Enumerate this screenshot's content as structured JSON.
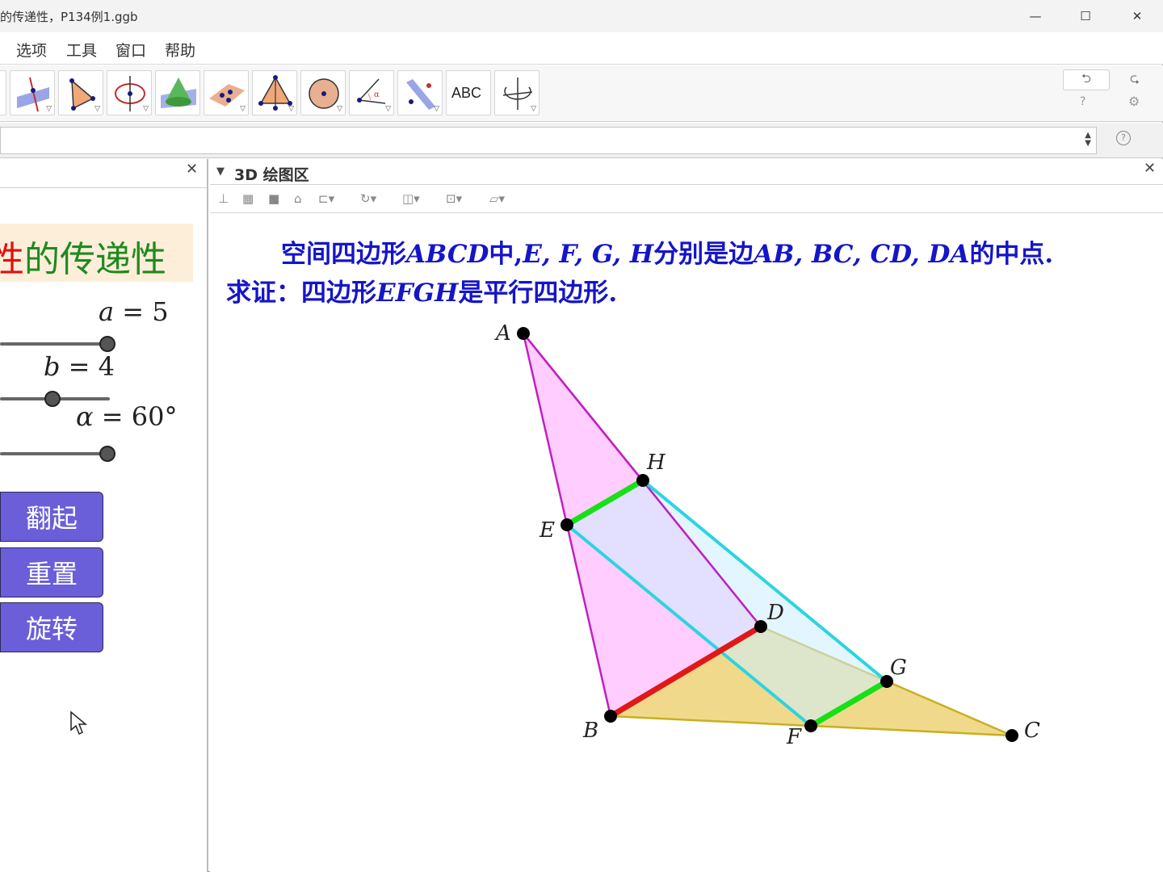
{
  "window": {
    "title": "的传递性，P134例1.ggb",
    "minimize": "—",
    "maximize": "☐",
    "close": "✕"
  },
  "menu": [
    "选项",
    "工具",
    "窗口",
    "帮助"
  ],
  "toolbar": {
    "tools": [
      {
        "icon": "line-plane-icon"
      },
      {
        "icon": "polygon-icon"
      },
      {
        "icon": "circle-axis-icon"
      },
      {
        "icon": "cone-icon"
      },
      {
        "icon": "points-on-plane-icon"
      },
      {
        "icon": "pyramid-icon"
      },
      {
        "icon": "sphere-icon"
      },
      {
        "icon": "angle-icon"
      },
      {
        "icon": "reflect-icon"
      },
      {
        "icon": "text-icon",
        "label": "ABC"
      },
      {
        "icon": "rotate-view-icon"
      }
    ],
    "undo": "⮌",
    "redo": "⮎"
  },
  "left_panel": {
    "banner_red": "性",
    "banner_green": "的传递性",
    "sliders": [
      {
        "var": "a",
        "value": "5",
        "level": 1.0
      },
      {
        "var": "b",
        "value": "4",
        "level": 0.49
      },
      {
        "var": "α",
        "value": "60°",
        "level": 1.0
      }
    ],
    "buttons": [
      "翻起",
      "重置",
      "旋转"
    ]
  },
  "view3d": {
    "title": "3D 绘图区",
    "problem_line1": {
      "a": "空间四边形",
      "b": "ABCD",
      "c": "中,",
      "d": "E, F, G, H",
      "e": "分别是边",
      "f": "AB, BC, CD, DA",
      "g": "的中点."
    },
    "problem_line2": {
      "a": "求证：四边形",
      "b": "EFGH",
      "c": "是平行四边形."
    },
    "points": [
      "A",
      "B",
      "C",
      "D",
      "E",
      "F",
      "G",
      "H"
    ]
  }
}
